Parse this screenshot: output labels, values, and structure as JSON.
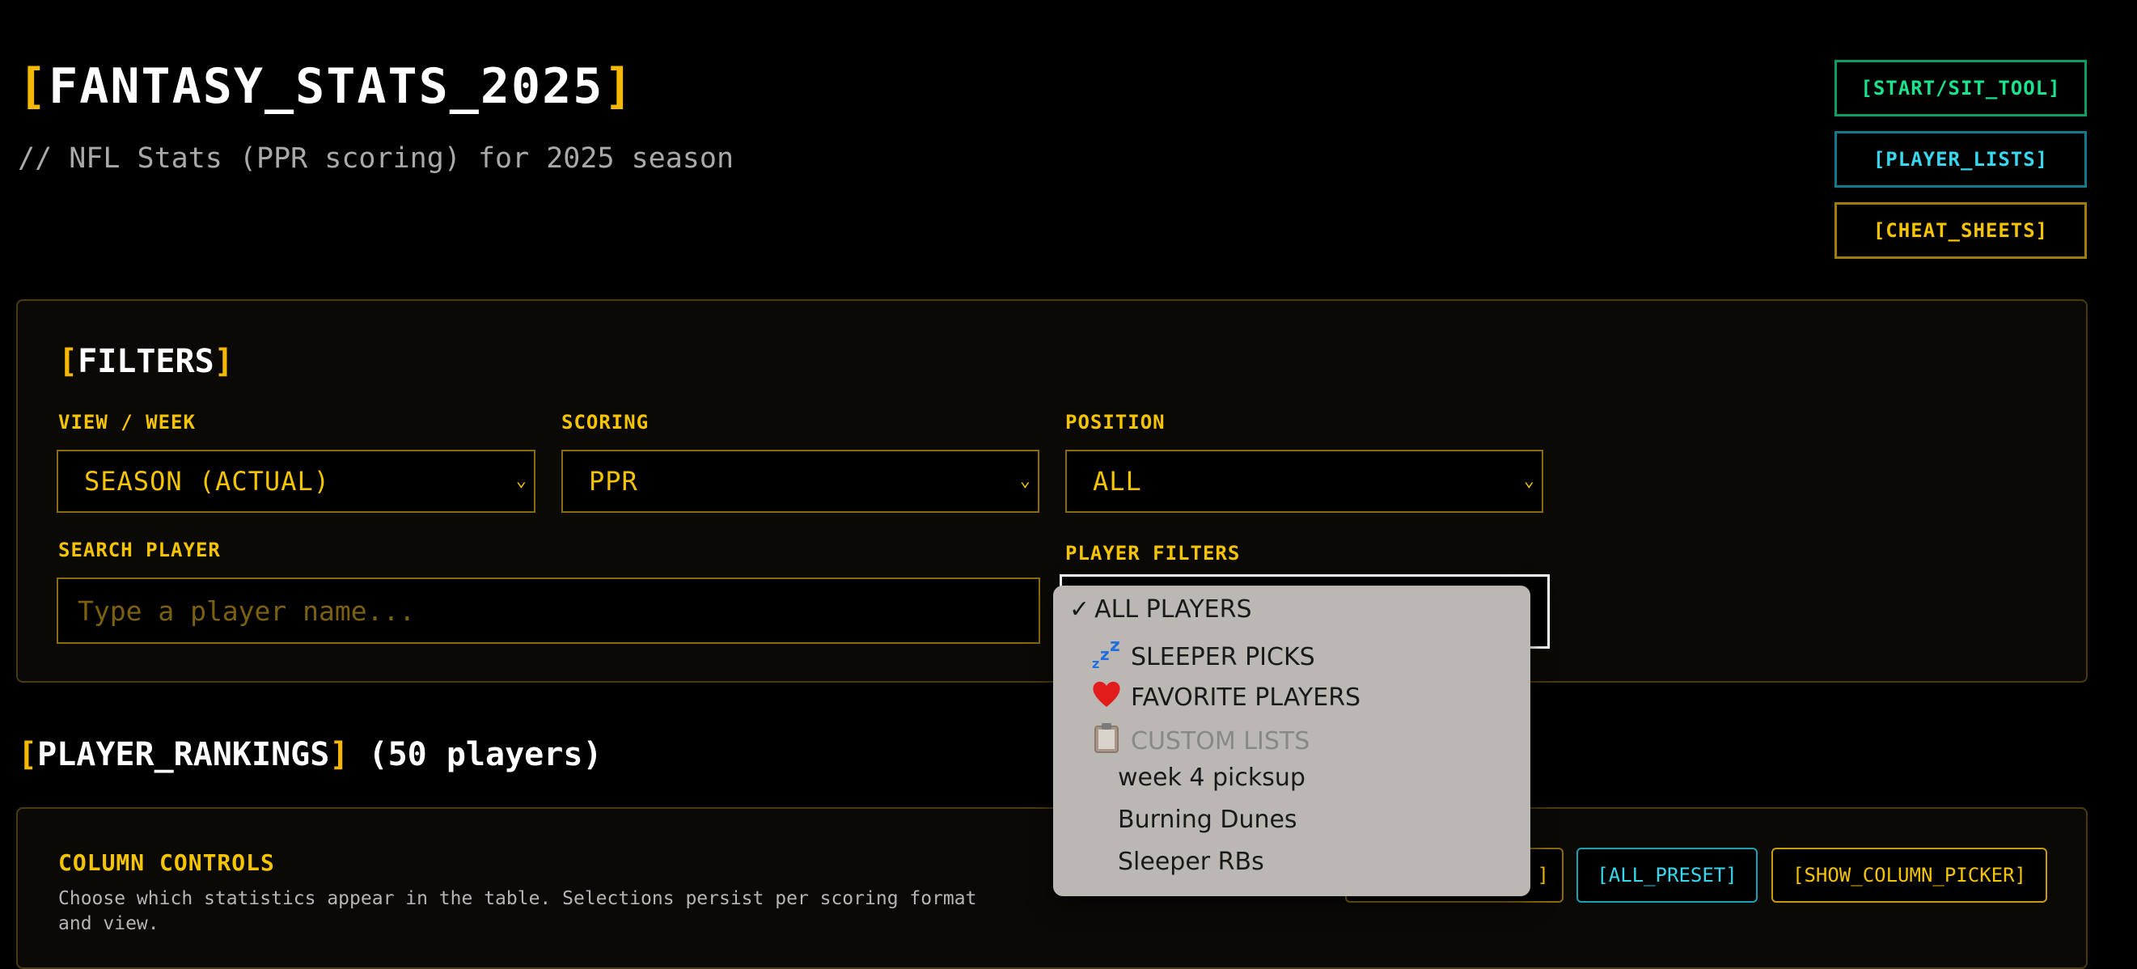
{
  "header": {
    "title_open": "[",
    "title_text": "FANTASY_STATS_2025",
    "title_close": "]",
    "subtitle": "// NFL Stats (PPR scoring) for 2025 season"
  },
  "nav": {
    "start_sit": "[START/SIT_TOOL]",
    "player_lists": "[PLAYER_LISTS]",
    "cheat_sheets": "[CHEAT_SHEETS]"
  },
  "filters": {
    "title_open": "[",
    "title_text": "FILTERS",
    "title_close": "]",
    "view_label": "VIEW / WEEK",
    "view_value": "SEASON (ACTUAL)",
    "scoring_label": "SCORING",
    "scoring_value": "PPR",
    "position_label": "POSITION",
    "position_value": "ALL",
    "search_label": "SEARCH PLAYER",
    "search_placeholder": "Type a player name...",
    "player_filters_label": "PLAYER FILTERS"
  },
  "player_filters_menu": {
    "items": [
      {
        "label": "ALL PLAYERS",
        "icon": "checkmark-icon",
        "selected": true
      },
      {
        "label": "SLEEPER PICKS",
        "icon": "zzz-icon"
      },
      {
        "label": "FAVORITE PLAYERS",
        "icon": "heart-icon"
      },
      {
        "label": "CUSTOM LISTS",
        "icon": "clipboard-icon",
        "disabled": true
      },
      {
        "label": "week 4 picksup"
      },
      {
        "label": "Burning Dunes"
      },
      {
        "label": "Sleeper RBs"
      }
    ]
  },
  "rankings": {
    "title_open": "[",
    "title_text": "PLAYER_RANKINGS",
    "title_close": "]",
    "count": "(50 players)"
  },
  "column_controls": {
    "title": "COLUMN CONTROLS",
    "description": "Choose which statistics appear in the table. Selections persist per scoring format and view.",
    "partial_button_visible_text": "]",
    "all_preset": "[ALL_PRESET]",
    "show_picker": "[SHOW_COLUMN_PICKER]"
  },
  "colors": {
    "accent_yellow": "#f5b800",
    "green": "#19e38d",
    "cyan": "#38d7f0",
    "background": "#000000"
  }
}
